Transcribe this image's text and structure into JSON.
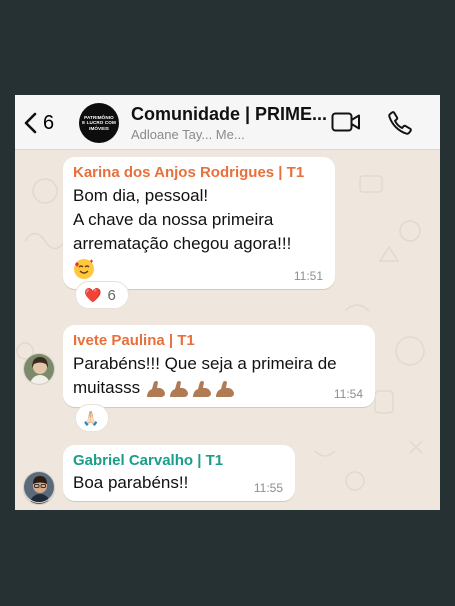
{
  "header": {
    "back_count": "6",
    "group_avatar_text": "PATRIMÔNIO E LUCRO COM IMÓVEIS",
    "title": "Comunidade | PRIME...",
    "members": "Adloane Tay... Me..."
  },
  "messages": [
    {
      "sender": "Karina dos Anjos Rodrigues | T1",
      "sender_color": "#e8703a",
      "lines": [
        "Bom dia, pessoal!",
        "A chave da nossa primeira",
        "arrematação chegou agora!!!"
      ],
      "emoji": "smiling-face-with-hearts",
      "time": "11:51",
      "reaction": {
        "emoji": "❤️",
        "count": "6"
      }
    },
    {
      "sender": "Ivete Paulina | T1",
      "sender_color": "#e8703a",
      "lines": [
        "Parabéns!!! Que seja a primeira de",
        "muitasss"
      ],
      "emoji": "flexed-biceps x4",
      "time": "11:54",
      "reaction": {
        "emoji": "🙏🏻",
        "count": ""
      }
    },
    {
      "sender": "Gabriel Carvalho | T1",
      "sender_color": "#1a9e8a",
      "lines": [
        "Boa parabéns!!"
      ],
      "time": "11:55"
    }
  ],
  "colors": {
    "chat_background": "#efe7dd",
    "header_background": "#f6f6f6",
    "page_background": "#253133"
  }
}
